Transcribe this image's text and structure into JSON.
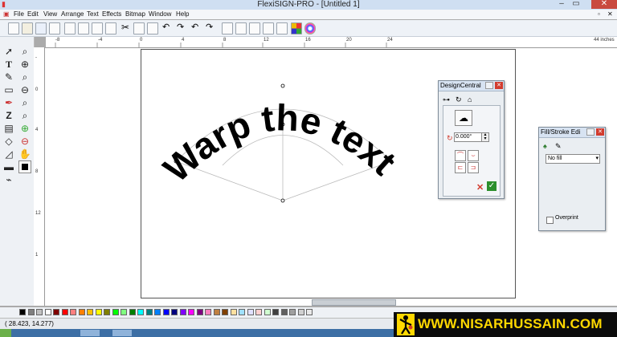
{
  "window": {
    "title": "FlexiSIGN-PRO - [Untitled 1]"
  },
  "menu": [
    "File",
    "Edit",
    "View",
    "Arrange",
    "Text",
    "Effects",
    "Bitmap",
    "Window",
    "Help"
  ],
  "ruler": {
    "h_ticks": [
      "-8",
      "-4",
      "0",
      "4",
      "8",
      "12",
      "16",
      "20",
      "24",
      "44 inches"
    ],
    "v_ticks": [
      "-",
      "0",
      "4",
      "8",
      "12",
      "1"
    ]
  },
  "canvas": {
    "warp_text": "Warp the text."
  },
  "design_central": {
    "title": "DesignCentral",
    "angle_value": "0.000°"
  },
  "fill_stroke": {
    "title": "Fill/Stroke Edi",
    "fill_value": "No fill",
    "overprint_label": "Overprint"
  },
  "status": {
    "coords": "( 28.423,   14.277)"
  },
  "banner": {
    "text": "WWW.NISARHUSSAIN.COM"
  },
  "colors": {
    "accent": "#ffd800",
    "close": "#d23c2e",
    "banner_bg": "#0b0b0b"
  }
}
